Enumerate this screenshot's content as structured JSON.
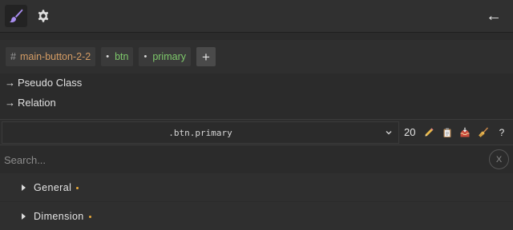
{
  "colors": {
    "accent_brush": "#a98ef0",
    "id_text": "#d49c64",
    "class_text": "#7ec96b",
    "modified_dot": "#e8a93a"
  },
  "topbar": {
    "style_manager_icon": "paint-brush-icon",
    "settings_icon": "gear-icon",
    "back_label": "←"
  },
  "selectors": {
    "id_prefix": "#",
    "id_name": "main-button-2-2",
    "classes": [
      {
        "bullet": "•",
        "name": "btn"
      },
      {
        "bullet": "•",
        "name": "primary"
      }
    ],
    "add_label": "+"
  },
  "links": {
    "pseudo_class": "Pseudo Class",
    "relation": "Relation",
    "arrow": "→"
  },
  "state": {
    "selected": ".btn.primary",
    "count": "20"
  },
  "tools": [
    "pencil-icon",
    "clipboard-icon",
    "inbox-tray-icon",
    "broom-icon",
    "help-icon"
  ],
  "help_label": "?",
  "search": {
    "placeholder": "Search...",
    "clear_label": "X"
  },
  "sectors": [
    {
      "label": "General"
    },
    {
      "label": "Dimension"
    }
  ]
}
